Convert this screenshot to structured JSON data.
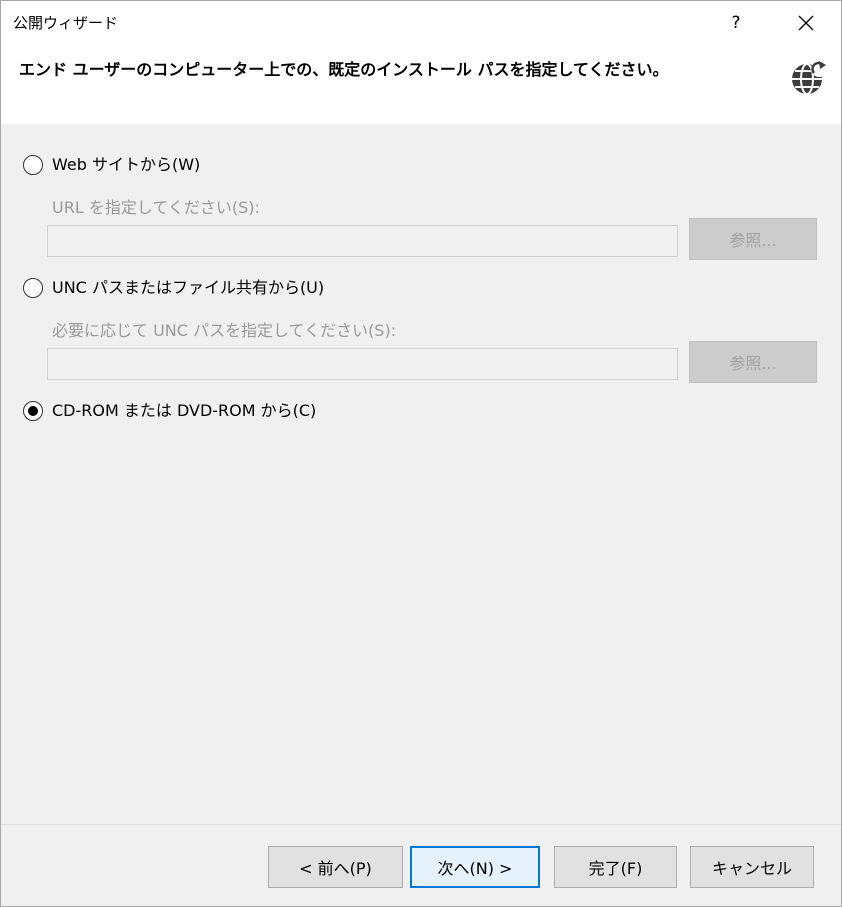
{
  "window": {
    "title": "公開ウィザード",
    "help_label": "?",
    "close_label": "✕"
  },
  "header": {
    "text": "エンド ユーザーのコンピューター上での、既定のインストール パスを指定してください。",
    "icon": "globe-upload-icon"
  },
  "options": {
    "web": {
      "label": "Web サイトから(W)",
      "selected": false,
      "field_label": "URL を指定してください(S):",
      "field_value": "",
      "browse_label": "参照..."
    },
    "unc": {
      "label": "UNC パスまたはファイル共有から(U)",
      "selected": false,
      "field_label": "必要に応じて UNC パスを指定してください(S):",
      "field_value": "",
      "browse_label": "参照..."
    },
    "cdrom": {
      "label": "CD-ROM または DVD-ROM から(C)",
      "selected": true
    }
  },
  "footer": {
    "back_label": "< 前へ(P)",
    "next_label": "次へ(N) >",
    "finish_label": "完了(F)",
    "cancel_label": "キャンセル"
  },
  "colors": {
    "accent": "#0078d7",
    "background": "#f0f0f0",
    "disabled_text": "#9a9a9a"
  }
}
